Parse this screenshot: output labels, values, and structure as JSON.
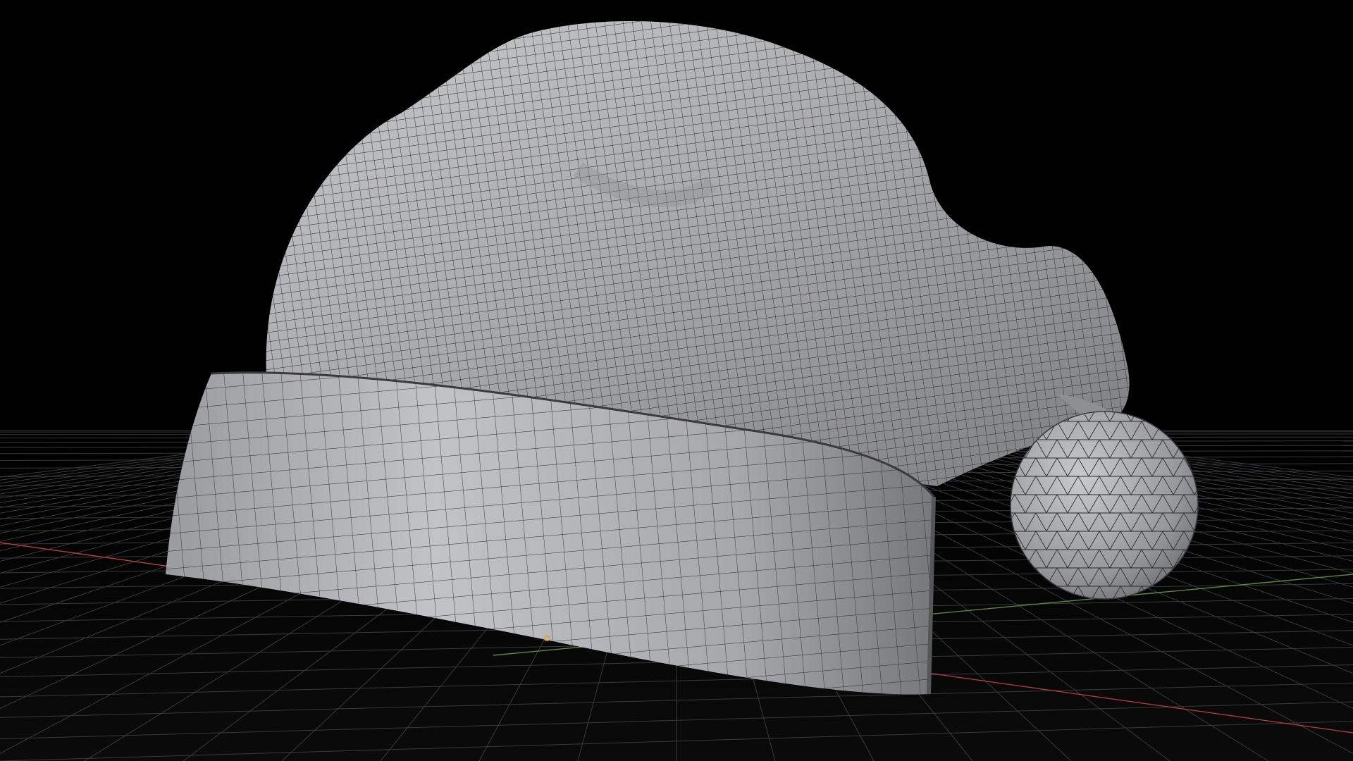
{
  "scene": {
    "object_name": "santa-hat",
    "display_mode": "wireframe-on-shaded",
    "floor_grid": "on",
    "axis_x_visible": true,
    "axis_y_visible": true,
    "object_origin_visible": true
  },
  "colors": {
    "background": "#000000",
    "grid": "#4a4a4e",
    "axis_x": "#b23a3a",
    "axis_y": "#5f8a3a",
    "surface_light": "#c4c5c8",
    "surface_dark": "#6e6f73",
    "wire": "#2b2b2d",
    "origin_dot": "#e0a030"
  }
}
